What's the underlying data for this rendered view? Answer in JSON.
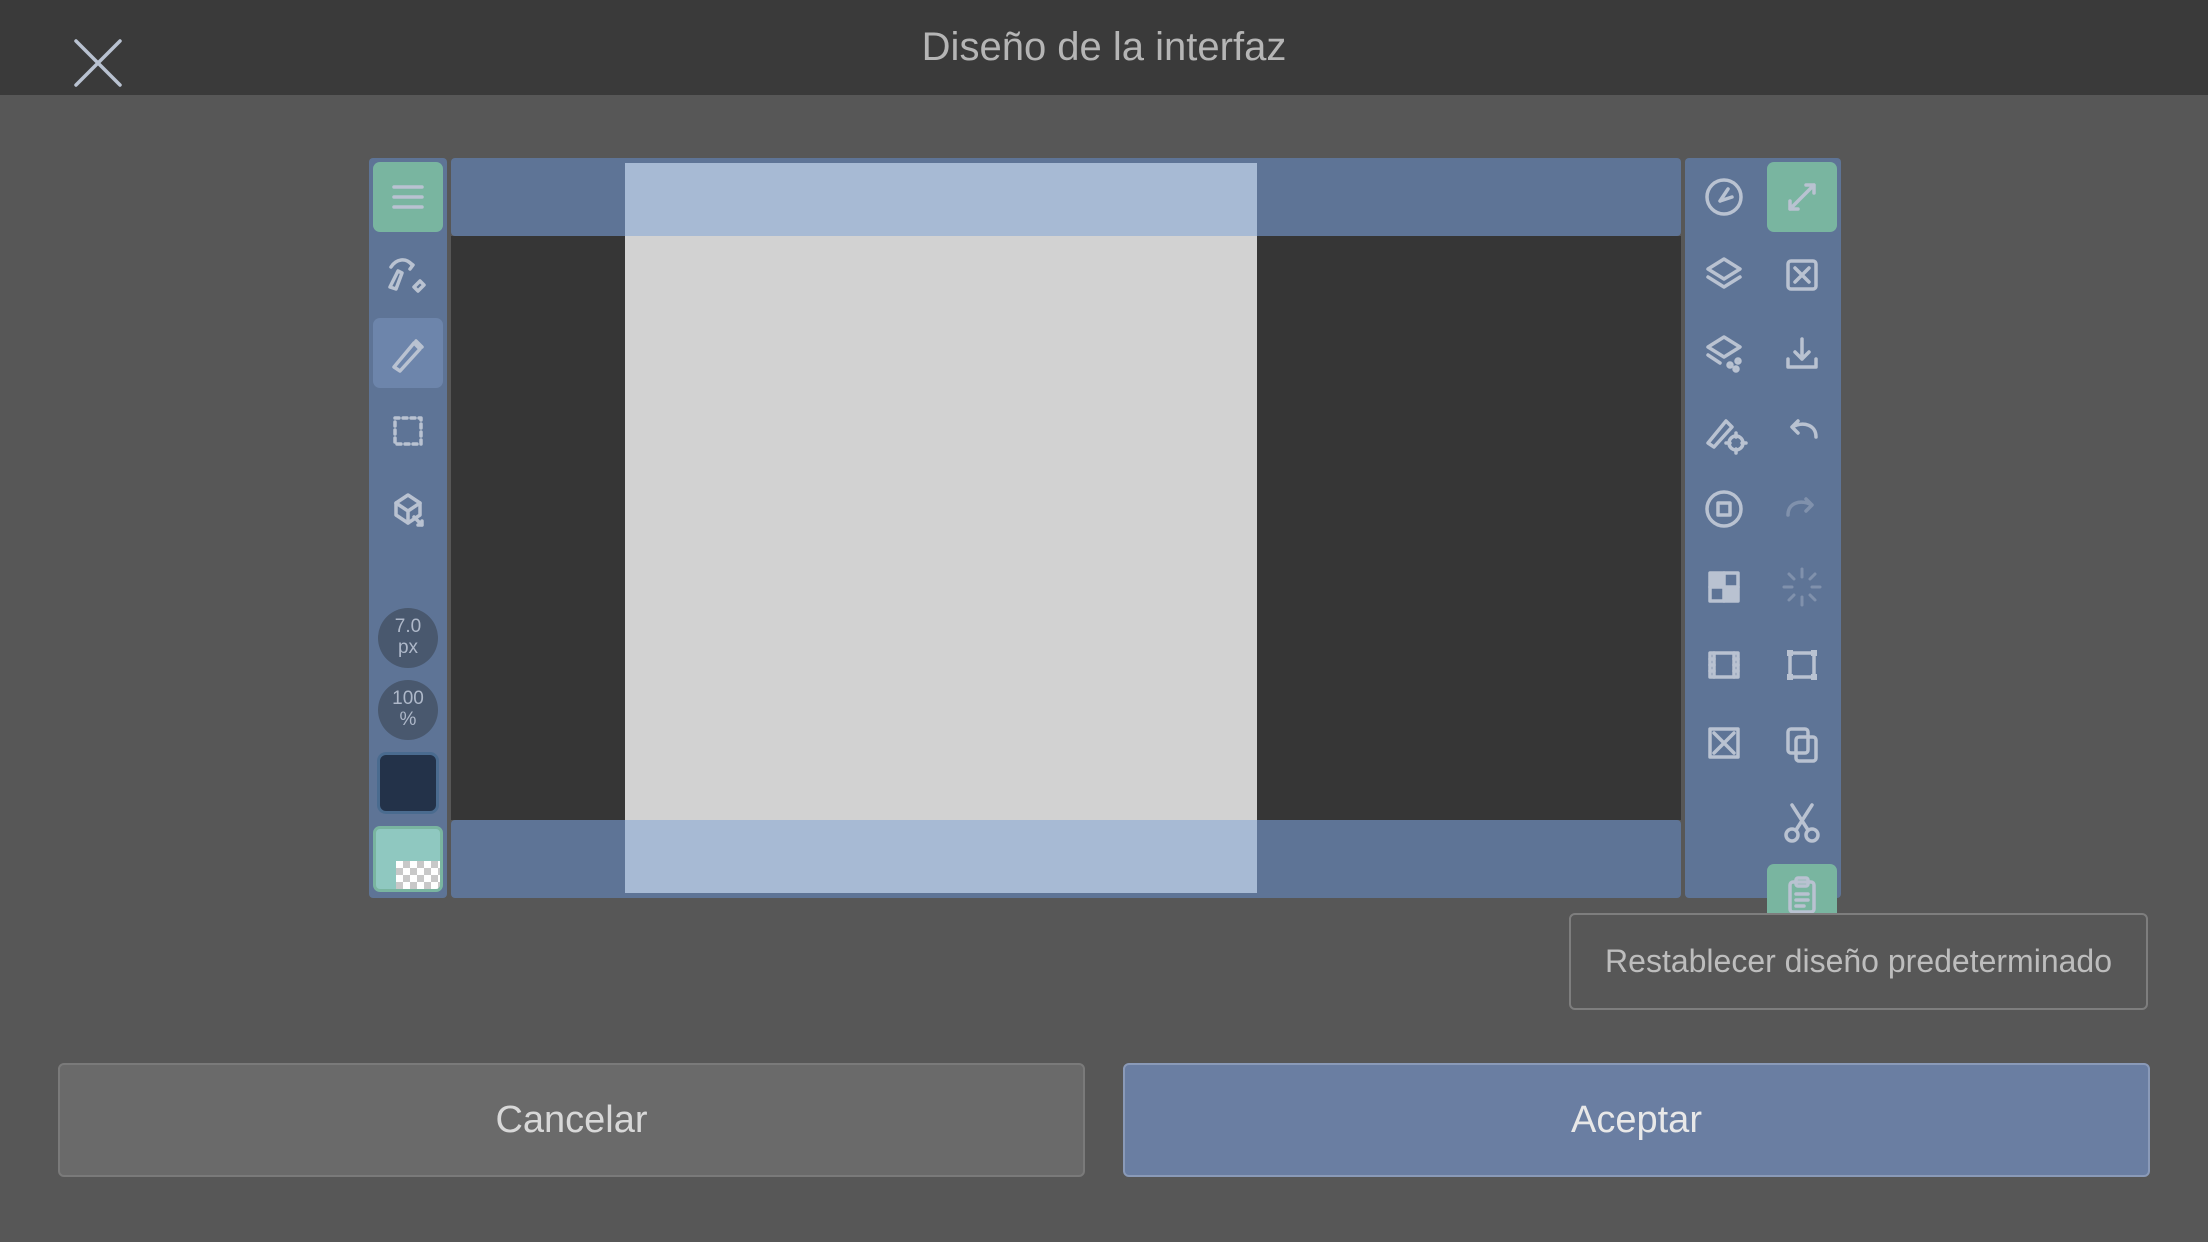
{
  "header": {
    "title": "Diseño de la interfaz"
  },
  "left_toolbar": {
    "brush_size": "7.0",
    "brush_unit": "px",
    "opacity_value": "100",
    "opacity_unit": "%"
  },
  "colors": {
    "primary": "#233249",
    "secondary": "#8fc8c0"
  },
  "actions": {
    "reset": "Restablecer diseño predeterminado",
    "cancel": "Cancelar",
    "accept": "Aceptar"
  }
}
